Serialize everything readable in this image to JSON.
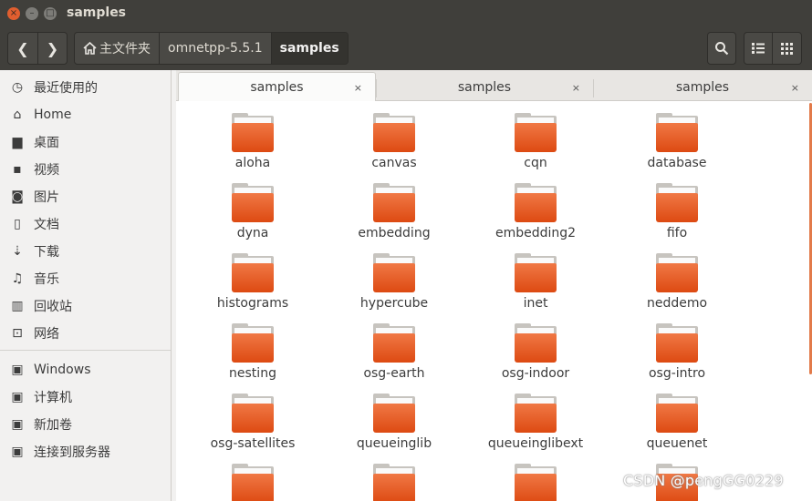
{
  "window": {
    "title": "samples",
    "close_glyph": "×",
    "min_glyph": "–",
    "max_glyph": "□"
  },
  "toolbar": {
    "back_glyph": "❮",
    "forward_glyph": "❯",
    "breadcrumbs": [
      {
        "label": "主文件夹",
        "icon": "home-icon"
      },
      {
        "label": "omnetpp-5.5.1"
      },
      {
        "label": "samples"
      }
    ],
    "search_icon": "search-icon",
    "list_icon": "list-view-icon",
    "grid_icon": "grid-view-icon"
  },
  "sidebar": {
    "items": [
      {
        "label": "最近使用的",
        "icon": "clock-icon",
        "glyph": "◷"
      },
      {
        "label": "Home",
        "icon": "home-icon",
        "glyph": "⌂"
      },
      {
        "label": "桌面",
        "icon": "folder-icon",
        "glyph": "▆"
      },
      {
        "label": "视频",
        "icon": "video-icon",
        "glyph": "▪"
      },
      {
        "label": "图片",
        "icon": "camera-icon",
        "glyph": "◙"
      },
      {
        "label": "文档",
        "icon": "document-icon",
        "glyph": "▯"
      },
      {
        "label": "下载",
        "icon": "download-icon",
        "glyph": "⇣"
      },
      {
        "label": "音乐",
        "icon": "music-icon",
        "glyph": "♫"
      },
      {
        "label": "回收站",
        "icon": "trash-icon",
        "glyph": "▥"
      },
      {
        "label": "网络",
        "icon": "network-icon",
        "glyph": "⊡"
      }
    ],
    "devices": [
      {
        "label": "Windows",
        "icon": "drive-icon",
        "glyph": "▣"
      },
      {
        "label": "计算机",
        "icon": "computer-icon",
        "glyph": "▣"
      },
      {
        "label": "新加卷",
        "icon": "drive-icon",
        "glyph": "▣"
      },
      {
        "label": "连接到服务器",
        "icon": "server-icon",
        "glyph": "▣"
      }
    ]
  },
  "tabs": [
    {
      "label": "samples",
      "close": "×",
      "active": true
    },
    {
      "label": "samples",
      "close": "×",
      "active": false
    },
    {
      "label": "samples",
      "close": "×",
      "active": false
    }
  ],
  "colors": {
    "accent": "#e05e2f",
    "folder": "#dd4a12",
    "titlebar": "#403f3b"
  },
  "files": [
    {
      "name": "aloha"
    },
    {
      "name": "canvas"
    },
    {
      "name": "cqn"
    },
    {
      "name": "database"
    },
    {
      "name": "dyna"
    },
    {
      "name": "embedding"
    },
    {
      "name": "embedding2"
    },
    {
      "name": "fifo"
    },
    {
      "name": "histograms"
    },
    {
      "name": "hypercube"
    },
    {
      "name": "inet"
    },
    {
      "name": "neddemo"
    },
    {
      "name": "nesting"
    },
    {
      "name": "osg-earth"
    },
    {
      "name": "osg-indoor"
    },
    {
      "name": "osg-intro"
    },
    {
      "name": "osg-satellites"
    },
    {
      "name": "queueinglib"
    },
    {
      "name": "queueinglibext"
    },
    {
      "name": "queuenet"
    },
    {
      "name": ""
    },
    {
      "name": ""
    },
    {
      "name": ""
    },
    {
      "name": ""
    }
  ],
  "watermark": "CSDN @pengGG0229"
}
